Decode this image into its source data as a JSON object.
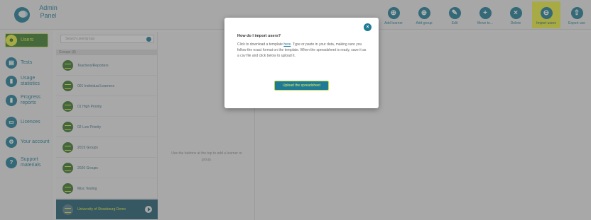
{
  "brand": {
    "line1": "Admin",
    "line2": "Panel"
  },
  "toolbar": [
    {
      "label": "Add learner",
      "icon": "add-learner-icon",
      "glyph": "⊕"
    },
    {
      "label": "Add group",
      "icon": "add-group-icon",
      "glyph": "⊕"
    },
    {
      "label": "Edit",
      "icon": "edit-icon",
      "glyph": "✎"
    },
    {
      "label": "Move to...",
      "icon": "move-icon",
      "glyph": "+"
    },
    {
      "label": "Delete",
      "icon": "delete-icon",
      "glyph": "×"
    },
    {
      "label": "Import users",
      "icon": "import-icon",
      "glyph": "⊖",
      "active": true
    },
    {
      "label": "Export use",
      "icon": "export-icon",
      "glyph": "⇧"
    }
  ],
  "nav": [
    {
      "label": "Users",
      "icon": "users-icon",
      "glyph": "☻",
      "selected": true
    },
    {
      "label": "Tests",
      "icon": "tests-icon",
      "glyph": "▤"
    },
    {
      "label": "Usage\nstatistics",
      "icon": "usage-statistics-icon",
      "glyph": "▮"
    },
    {
      "label": "Progress\nreports",
      "icon": "progress-reports-icon",
      "glyph": "▮"
    },
    {
      "label": "Licences",
      "icon": "licences-icon",
      "glyph": "▭"
    },
    {
      "label": "Your account",
      "icon": "account-icon",
      "glyph": "⚙"
    },
    {
      "label": "Support\nmaterials",
      "icon": "support-icon",
      "glyph": "?"
    }
  ],
  "search": {
    "placeholder": "Search user/group"
  },
  "groups_header": "Groups (8)",
  "groups": [
    {
      "label": "Teachers/Reporters"
    },
    {
      "label": "001 Individual Learners"
    },
    {
      "label": "01 High Priority"
    },
    {
      "label": "02 Low Priority"
    },
    {
      "label": "2019 Groups"
    },
    {
      "label": "2020 Groups"
    },
    {
      "label": "Misc Testing"
    },
    {
      "label": "University of Strasbourg Demo",
      "selected": true
    }
  ],
  "learners_hint": "Use the buttons at the top to add a learner or group.",
  "modal": {
    "title": "How do I import users?",
    "body_before": "Click to download a template ",
    "link": "here",
    "body_after": ". Type or paste in your data, making sure you follow the exact format on the template. When the spreadsheet is ready, save it as a csv file and click below to upload it.",
    "button": "Upload the spreadsheet"
  },
  "colors": {
    "brand": "#1f7a93",
    "highlight": "#e4ec3e",
    "group_green": "#3b7630",
    "selected_row": "#245e70"
  }
}
